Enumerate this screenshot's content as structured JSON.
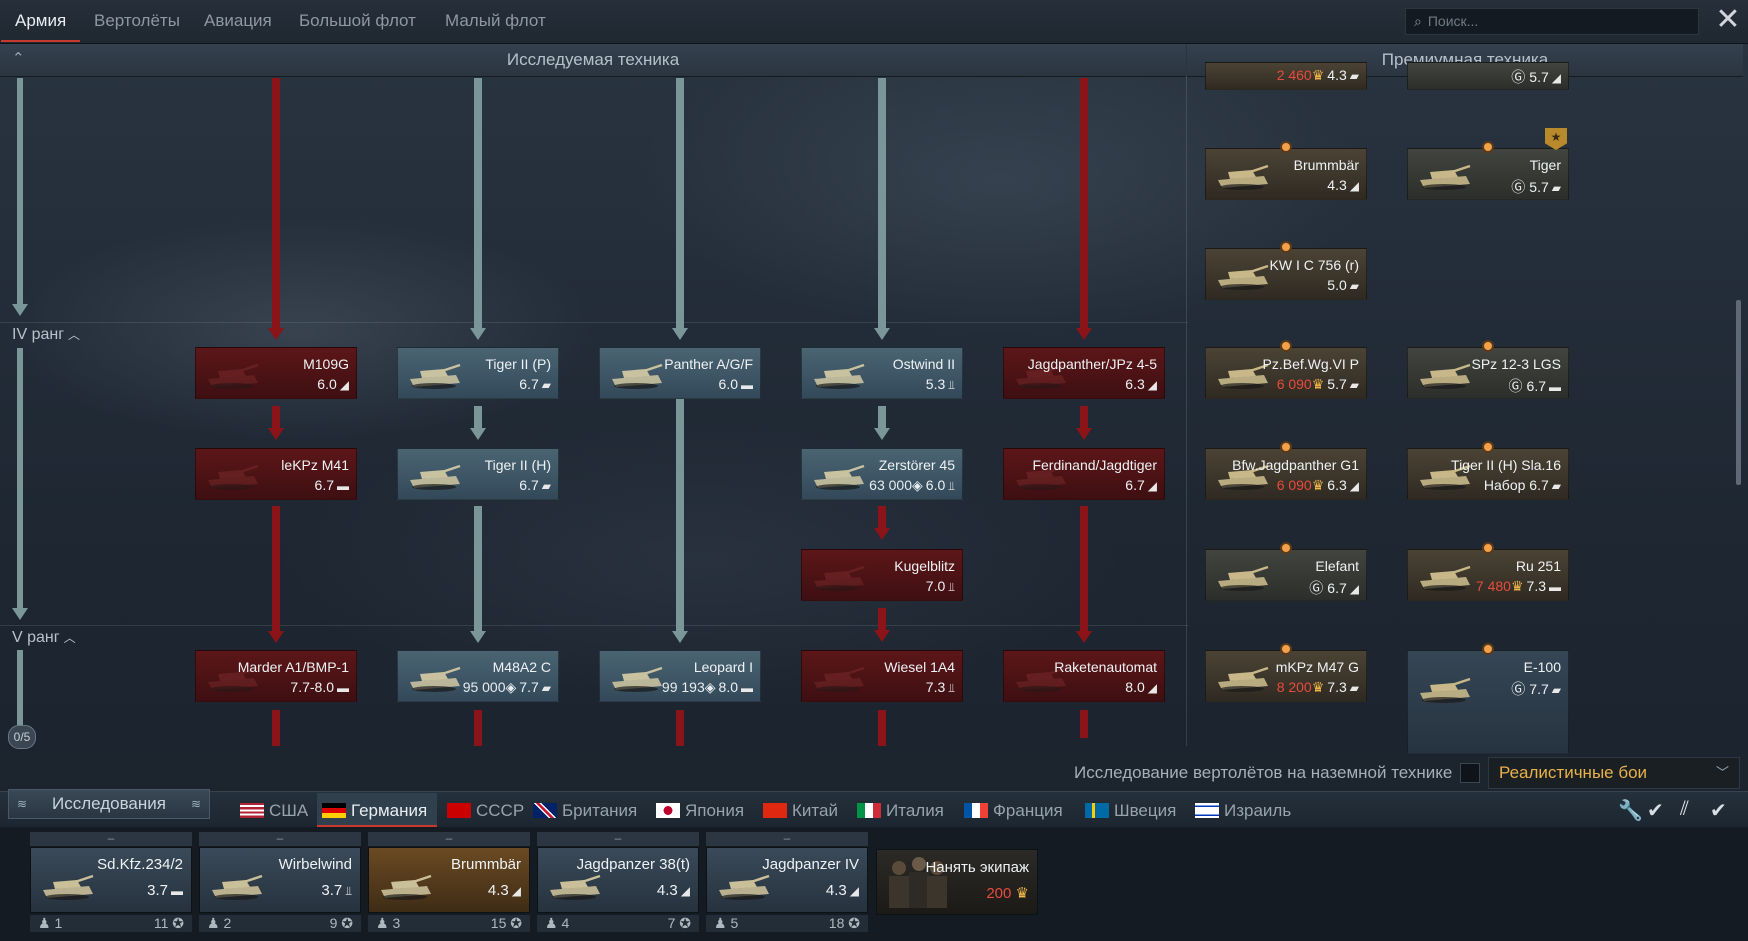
{
  "nav": {
    "tabs": [
      "Армия",
      "Вертолёты",
      "Авиация",
      "Большой флот",
      "Малый флот"
    ],
    "active": "Армия",
    "search_placeholder": "Поиск..."
  },
  "headers": {
    "researched": "Исследуемая техника",
    "premium": "Премиумная техника"
  },
  "ranks": {
    "r4": "IV ранг",
    "r5": "V ранг",
    "counter": "0/5"
  },
  "tree": [
    {
      "name": "M109G",
      "stat": "6.0",
      "role": "spg",
      "status": "locked"
    },
    {
      "name": "Tiger II (P)",
      "stat": "6.7",
      "role": "heavy",
      "status": "researched"
    },
    {
      "name": "Panther A/G/F",
      "stat": "6.0",
      "role": "medium",
      "status": "researched"
    },
    {
      "name": "Ostwind II",
      "stat": "5.3",
      "role": "spaa",
      "status": "researched"
    },
    {
      "name": "Jagdpanther/JPz 4-5",
      "stat": "6.3",
      "role": "td",
      "status": "locked"
    },
    {
      "name": "leKPz M41",
      "stat": "6.7",
      "role": "light",
      "status": "locked"
    },
    {
      "name": "Tiger II (H)",
      "stat": "6.7",
      "role": "heavy",
      "status": "researched"
    },
    {
      "name": "Zerstörer 45",
      "cost": "63 000",
      "stat": "6.0",
      "role": "spaa",
      "status": "researched"
    },
    {
      "name": "Ferdinand/Jagdtiger",
      "stat": "6.7",
      "role": "td",
      "status": "locked"
    },
    {
      "name": "Kugelblitz",
      "stat": "7.0",
      "role": "spaa",
      "status": "locked"
    },
    {
      "name": "Marder A1/BMP-1",
      "stat": "7.7-8.0",
      "role": "light",
      "status": "locked"
    },
    {
      "name": "M48A2 C",
      "cost": "95 000",
      "stat": "7.7",
      "role": "heavy",
      "status": "researched"
    },
    {
      "name": "Leopard I",
      "cost": "99 193",
      "stat": "8.0",
      "role": "medium",
      "status": "researched"
    },
    {
      "name": "Wiesel 1A4",
      "stat": "7.3",
      "role": "spaa",
      "status": "locked"
    },
    {
      "name": "Raketenautomat",
      "stat": "8.0",
      "role": "td",
      "status": "locked"
    }
  ],
  "premium": [
    {
      "name": "",
      "cost": "2 460",
      "stat": "4.3",
      "role": "heavy"
    },
    {
      "name": "",
      "stat": "5.7",
      "role": "td",
      "gold": true
    },
    {
      "name": "Brummbär",
      "stat": "4.3",
      "role": "td"
    },
    {
      "name": "Tiger",
      "stat": "5.7",
      "role": "heavy",
      "gold": true
    },
    {
      "name": "KW I C 756 (r)",
      "stat": "5.0",
      "role": "heavy"
    },
    {
      "name": "Pz.Bef.Wg.VI P",
      "cost": "6 090",
      "stat": "5.7",
      "role": "heavy"
    },
    {
      "name": "SPz 12-3 LGS",
      "stat": "6.7",
      "role": "light",
      "gold": true
    },
    {
      "name": "Bfw.Jagdpanther G1",
      "cost": "6 090",
      "stat": "6.3",
      "role": "td"
    },
    {
      "name": "Tiger II (H) Sla.16",
      "stat": "6.7",
      "role": "heavy",
      "note": "Набор"
    },
    {
      "name": "Elefant",
      "stat": "6.7",
      "role": "td",
      "gold": true
    },
    {
      "name": "Ru 251",
      "cost": "7 480",
      "stat": "7.3",
      "role": "light"
    },
    {
      "name": "mKPz M47 G",
      "cost": "8 200",
      "stat": "7.3",
      "role": "heavy"
    },
    {
      "name": "E-100",
      "stat": "7.7",
      "role": "heavy",
      "gold": true
    }
  ],
  "options": {
    "heli_research": "Исследование вертолётов на наземной технике",
    "mode": "Реалистичные бои"
  },
  "research_button": "Исследования",
  "nations": [
    {
      "name": "США",
      "active": false
    },
    {
      "name": "Германия",
      "active": true
    },
    {
      "name": "СССР",
      "active": false
    },
    {
      "name": "Британия",
      "active": false
    },
    {
      "name": "Япония",
      "active": false
    },
    {
      "name": "Китай",
      "active": false
    },
    {
      "name": "Италия",
      "active": false
    },
    {
      "name": "Франция",
      "active": false
    },
    {
      "name": "Швеция",
      "active": false
    },
    {
      "name": "Израиль",
      "active": false
    }
  ],
  "crew": [
    {
      "name": "Sd.Kfz.234/2",
      "br": "3.7",
      "role": "light",
      "n": "1",
      "lvl": "11"
    },
    {
      "name": "Wirbelwind",
      "br": "3.7",
      "role": "spaa",
      "n": "2",
      "lvl": "9"
    },
    {
      "name": "Brummbär",
      "br": "4.3",
      "role": "td",
      "n": "3",
      "lvl": "15",
      "selected": true
    },
    {
      "name": "Jagdpanzer 38(t)",
      "br": "4.3",
      "role": "td",
      "n": "4",
      "lvl": "7"
    },
    {
      "name": "Jagdpanzer IV",
      "br": "4.3",
      "role": "td",
      "n": "5",
      "lvl": "18"
    }
  ],
  "hire": {
    "label": "Нанять экипаж",
    "price": "200"
  },
  "role_glyphs": {
    "heavy": "▰",
    "medium": "▬",
    "light": "▬",
    "td": "◢",
    "spaa": "⫫",
    "spg": "◢"
  }
}
